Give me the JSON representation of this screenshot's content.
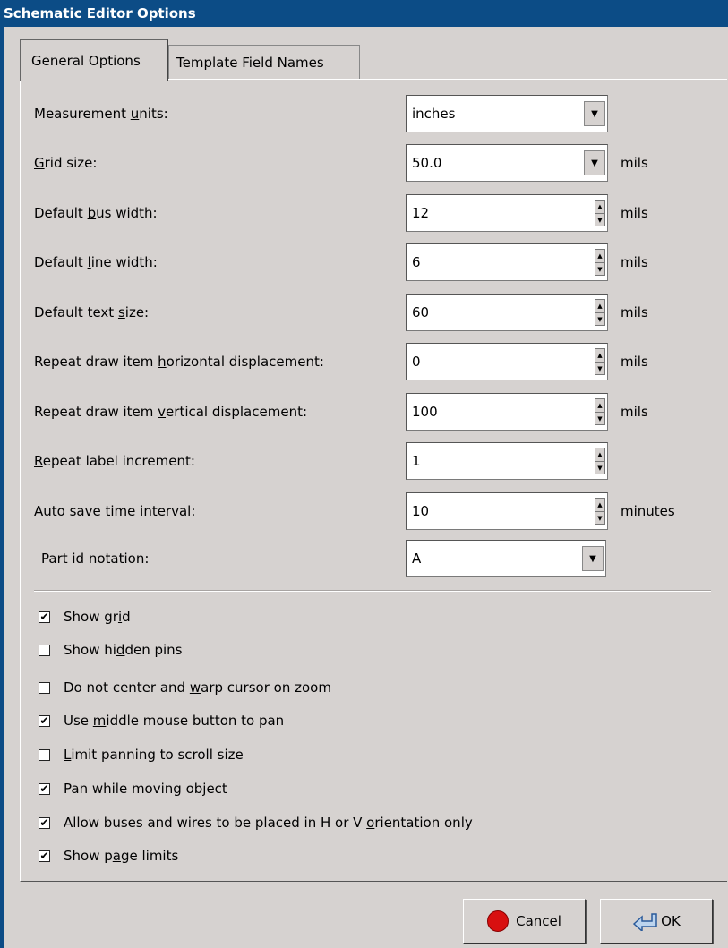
{
  "window": {
    "title": "Schematic Editor Options"
  },
  "tabs": [
    {
      "label": "General Options",
      "active": true
    },
    {
      "label": "Template Field Names",
      "active": false
    }
  ],
  "fields": {
    "measurement_units": {
      "label_pre": "Measurement ",
      "label_u": "u",
      "label_post": "nits:",
      "value": "inches",
      "unit": ""
    },
    "grid_size": {
      "label_pre": "",
      "label_u": "G",
      "label_post": "rid size:",
      "value": "50.0",
      "unit": "mils"
    },
    "bus_width": {
      "label_pre": "Default ",
      "label_u": "b",
      "label_post": "us width:",
      "value": "12",
      "unit": "mils"
    },
    "line_width": {
      "label_pre": "Default ",
      "label_u": "l",
      "label_post": "ine width:",
      "value": "6",
      "unit": "mils"
    },
    "text_size": {
      "label_pre": "Default text ",
      "label_u": "s",
      "label_post": "ize:",
      "value": "60",
      "unit": "mils"
    },
    "h_displacement": {
      "label_pre": "Repeat draw item ",
      "label_u": "h",
      "label_post": "orizontal displacement:",
      "value": "0",
      "unit": "mils"
    },
    "v_displacement": {
      "label_pre": "Repeat draw item ",
      "label_u": "v",
      "label_post": "ertical displacement:",
      "value": "100",
      "unit": "mils"
    },
    "label_increment": {
      "label_pre": "",
      "label_u": "R",
      "label_post": "epeat label increment:",
      "value": "1",
      "unit": ""
    },
    "autosave": {
      "label_pre": "Auto save ",
      "label_u": "t",
      "label_post": "ime interval:",
      "value": "10",
      "unit": "minutes"
    },
    "part_id": {
      "label_pre": "Part id notation:",
      "label_u": "",
      "label_post": "",
      "value": "A",
      "unit": ""
    }
  },
  "checkboxes": [
    {
      "pre": "Show gr",
      "u": "i",
      "post": "d",
      "checked": true,
      "mark": "✔"
    },
    {
      "pre": "Show hi",
      "u": "d",
      "post": "den pins",
      "checked": false,
      "mark": ""
    },
    {
      "pre": "Do not center and ",
      "u": "w",
      "post": "arp cursor on zoom",
      "checked": false,
      "mark": ""
    },
    {
      "pre": "Use ",
      "u": "m",
      "post": "iddle mouse button to pan",
      "checked": true,
      "mark": "✔"
    },
    {
      "pre": "",
      "u": "L",
      "post": "imit panning to scroll size",
      "checked": false,
      "mark": ""
    },
    {
      "pre": "Pan while moving object",
      "u": "",
      "post": "",
      "checked": true,
      "mark": "✔"
    },
    {
      "pre": "Allow buses and wires to be placed in H or V ",
      "u": "o",
      "post": "rientation only",
      "checked": true,
      "mark": "✔"
    },
    {
      "pre": "Show p",
      "u": "a",
      "post": "ge limits",
      "checked": true,
      "mark": "✔"
    }
  ],
  "buttons": {
    "cancel": {
      "u": "C",
      "post": "ancel"
    },
    "ok": {
      "u": "O",
      "post": "K"
    }
  },
  "icons": {
    "cancel": "stop-icon",
    "ok": "enter-arrow-icon",
    "dropdown": "chevron-down-icon",
    "spin": "spin-arrows-icon"
  },
  "colors": {
    "titlebar": "#0c4c86",
    "background": "#d6d2d0",
    "stop": "#d81010"
  }
}
